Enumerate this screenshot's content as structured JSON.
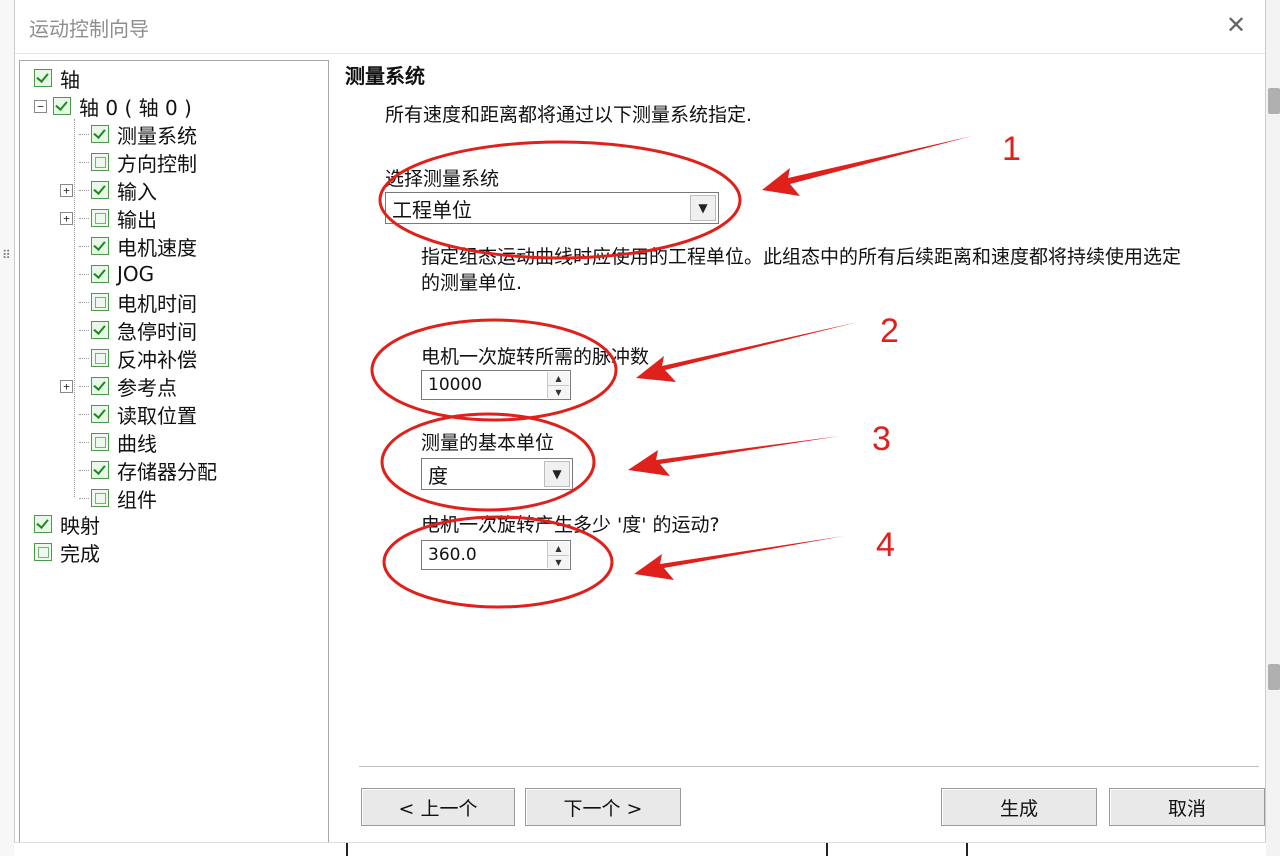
{
  "window": {
    "title": "运动控制向导",
    "close_glyph": "✕"
  },
  "tree": {
    "items": [
      {
        "label": "轴",
        "checked": true,
        "expander": ""
      },
      {
        "label": "轴 0 ( 轴 0 )",
        "checked": true,
        "expander": "−"
      },
      {
        "label": "测量系统",
        "checked": true,
        "expander": ""
      },
      {
        "label": "方向控制",
        "checked": false,
        "expander": ""
      },
      {
        "label": "输入",
        "checked": true,
        "expander": "+"
      },
      {
        "label": "输出",
        "checked": false,
        "expander": "+"
      },
      {
        "label": "电机速度",
        "checked": true,
        "expander": ""
      },
      {
        "label": "JOG",
        "checked": true,
        "expander": ""
      },
      {
        "label": "电机时间",
        "checked": false,
        "expander": ""
      },
      {
        "label": "急停时间",
        "checked": true,
        "expander": ""
      },
      {
        "label": "反冲补偿",
        "checked": false,
        "expander": ""
      },
      {
        "label": "参考点",
        "checked": true,
        "expander": "+"
      },
      {
        "label": "读取位置",
        "checked": true,
        "expander": ""
      },
      {
        "label": "曲线",
        "checked": false,
        "expander": ""
      },
      {
        "label": "存储器分配",
        "checked": true,
        "expander": ""
      },
      {
        "label": "组件",
        "checked": false,
        "expander": ""
      },
      {
        "label": "映射",
        "checked": true,
        "expander": ""
      },
      {
        "label": "完成",
        "checked": false,
        "expander": ""
      }
    ]
  },
  "content": {
    "section_title": "测量系统",
    "intro": "所有速度和距离都将通过以下测量系统指定.",
    "measure_system_label": "选择测量系统",
    "measure_system_value": "工程单位",
    "description": "指定组态运动曲线时应使用的工程单位。此组态中的所有后续距离和速度都将持续使用选定的测量单位.",
    "pulses_label": "电机一次旋转所需的脉冲数",
    "pulses_value": "10000",
    "base_unit_label": "测量的基本单位",
    "base_unit_value": "度",
    "motion_label": "电机一次旋转产生多少 '度' 的运动?",
    "motion_value": "360.0"
  },
  "buttons": {
    "prev": "< 上一个",
    "next": "下一个 >",
    "generate": "生成",
    "cancel": "取消"
  },
  "annotations": [
    "1",
    "2",
    "3",
    "4"
  ],
  "colors": {
    "annotation": "#e0201b",
    "check": "#1d8a1d"
  }
}
